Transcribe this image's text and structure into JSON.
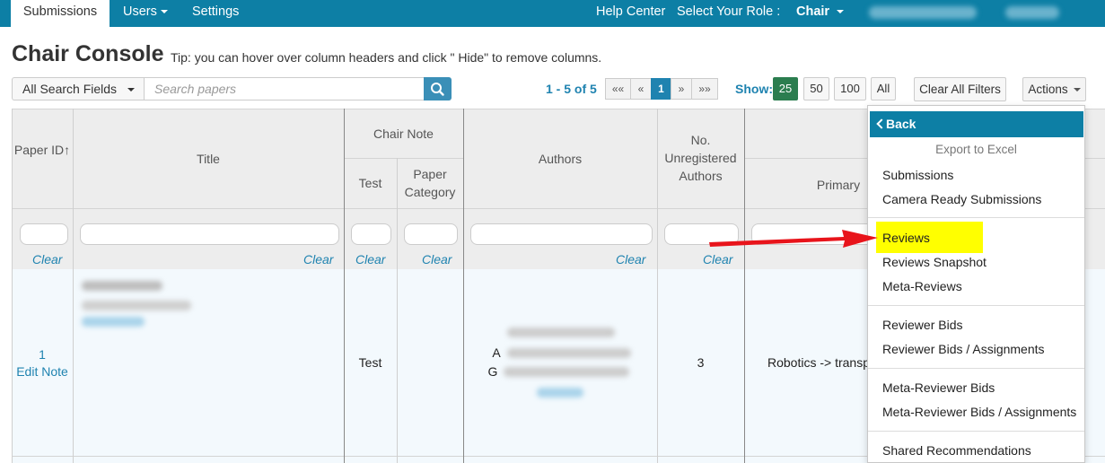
{
  "nav": {
    "submissions": "Submissions",
    "users": "Users",
    "settings": "Settings",
    "help_center": "Help Center",
    "select_role": "Select Your Role :",
    "role": "Chair"
  },
  "page": {
    "title": "Chair Console",
    "tip": "Tip: you can hover over column headers and click \" Hide\" to remove columns."
  },
  "toolbar": {
    "search_field": "All Search Fields",
    "search_placeholder": "Search papers",
    "page_range_prefix": "1 - 5 of",
    "total": "5",
    "pager": [
      "««",
      "«",
      "1",
      "»",
      "»»"
    ],
    "show_label": "Show:",
    "show_options": [
      "25",
      "50",
      "100",
      "All"
    ],
    "clear_filters": "Clear All Filters",
    "actions": "Actions"
  },
  "table": {
    "headers": {
      "paper_id": "Paper ID",
      "title": "Title",
      "chair_note": "Chair Note",
      "test": "Test",
      "paper_category": "Paper Category",
      "authors": "Authors",
      "no_unregistered": "No. Unregistered Authors",
      "primary": "Primary"
    },
    "clear_label": "Clear",
    "rows": [
      {
        "paper_id": "1",
        "edit_note": "Edit Note",
        "test": "Test",
        "author_prefix_1": "A",
        "author_prefix_2": "G",
        "unregistered": "3",
        "primary": "Robotics -> transp"
      }
    ]
  },
  "menu": {
    "back": "Back",
    "export_header": "Export to Excel",
    "items": [
      "Submissions",
      "Camera Ready Submissions",
      "Reviews",
      "Reviews Snapshot",
      "Meta-Reviews",
      "Reviewer Bids",
      "Reviewer Bids / Assignments",
      "Meta-Reviewer Bids",
      "Meta-Reviewer Bids / Assignments",
      "Shared Recommendations"
    ]
  },
  "colors": {
    "nav_bg": "#0d7fa5",
    "link": "#1f83b0",
    "show_active": "#2b7d4f",
    "highlight": "#ffff00",
    "arrow": "#e8141b"
  }
}
